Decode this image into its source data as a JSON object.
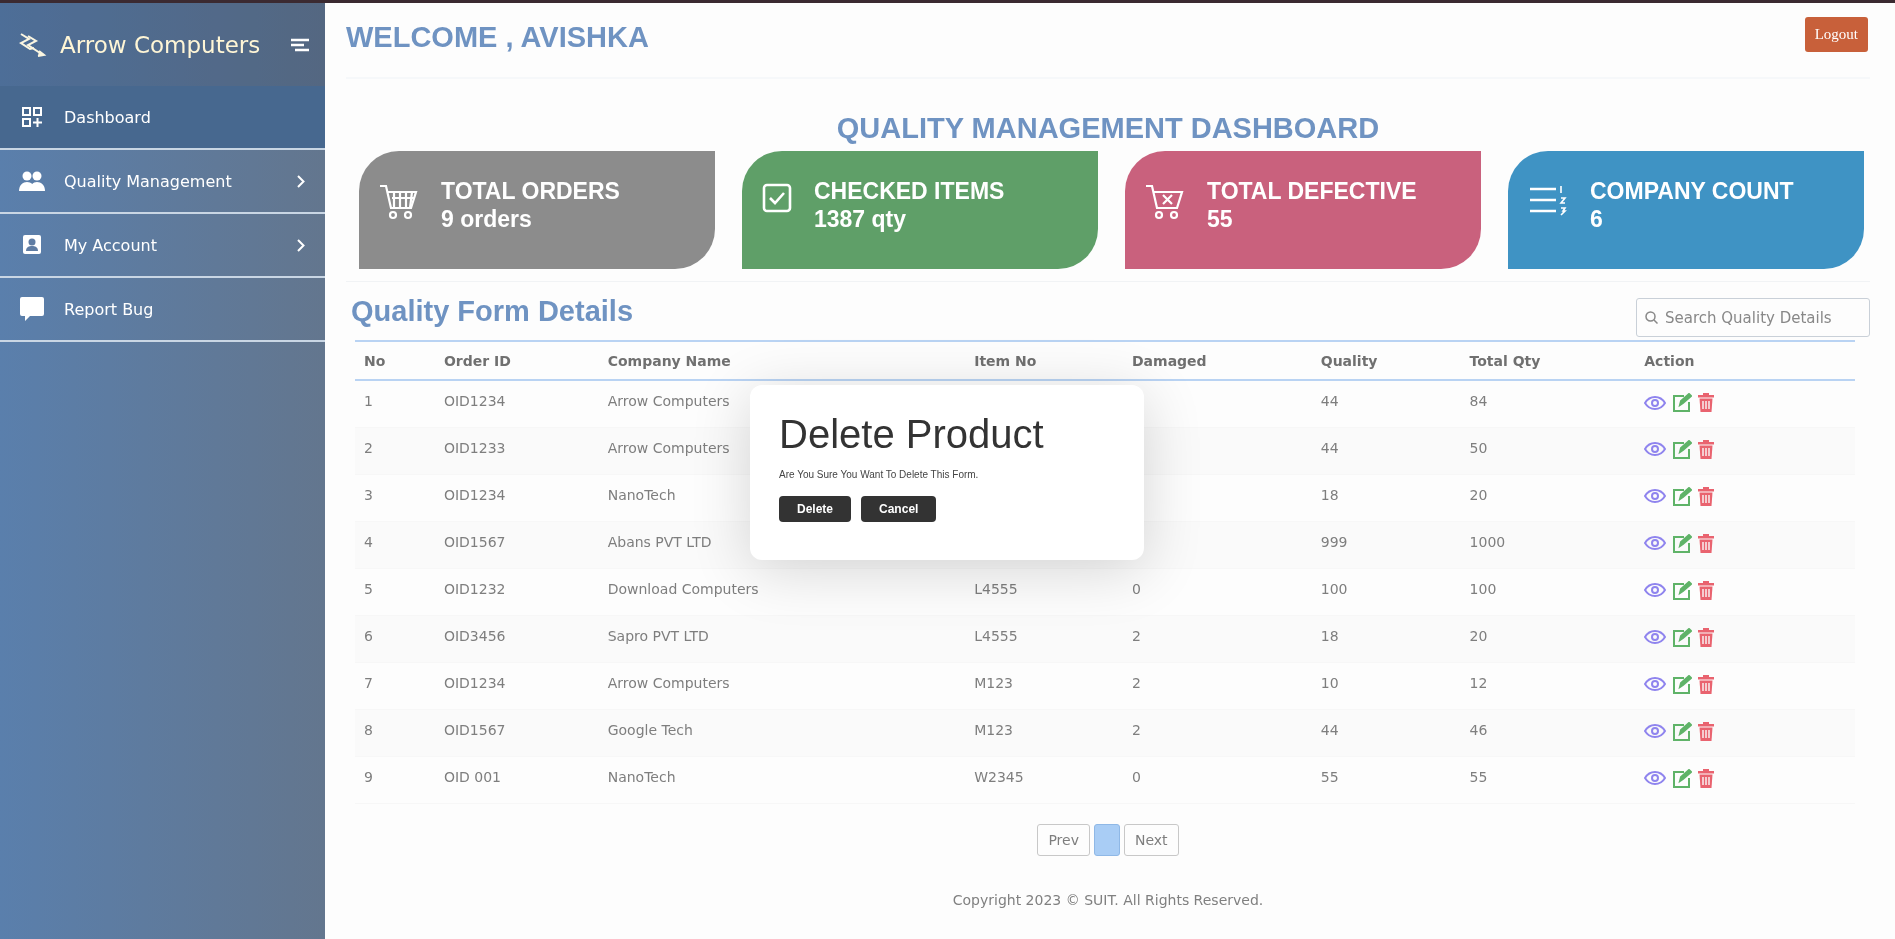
{
  "sidebar": {
    "brand": "Arrow Computers",
    "items": [
      {
        "label": "Dashboard",
        "selected": true,
        "kind": "dashboard"
      },
      {
        "label": "Quality Management",
        "selected": false,
        "kind": "people"
      },
      {
        "label": "My Account",
        "selected": false,
        "kind": "account"
      },
      {
        "label": "Report Bug",
        "selected": false,
        "kind": "chat"
      }
    ]
  },
  "header": {
    "welcome": "WELCOME , AVISHKA",
    "logout": "Logout"
  },
  "dashboard_title": "QUALITY MANAGEMENT DASHBOARD",
  "cards": [
    {
      "title": "TOTAL ORDERS",
      "value": "9 orders",
      "kind": "cart",
      "color": "#8c8c8c"
    },
    {
      "title": "CHECKED ITEMS",
      "value": "1387 qty",
      "kind": "check",
      "color": "#5f9f68"
    },
    {
      "title": "TOTAL DEFECTIVE",
      "value": "55",
      "kind": "cart-x",
      "color": "#c9617d"
    },
    {
      "title": "COMPANY COUNT",
      "value": "6",
      "kind": "list",
      "color": "#3f93c4"
    }
  ],
  "section_title": "Quality Form Details",
  "search": {
    "placeholder": "Search Quality Details"
  },
  "table": {
    "columns": [
      "No",
      "Order ID",
      "Company Name",
      "Item No",
      "Damaged",
      "Quality",
      "Total Qty",
      "Action"
    ],
    "rows": [
      {
        "no": "1",
        "order_id": "OID1234",
        "company": "Arrow Computers",
        "quality": "44",
        "total_qty": "84"
      },
      {
        "no": "2",
        "order_id": "OID1233",
        "company": "Arrow Computers",
        "quality": "44",
        "total_qty": "50"
      },
      {
        "no": "3",
        "order_id": "OID1234",
        "company": "NanoTech",
        "quality": "18",
        "total_qty": "20"
      },
      {
        "no": "4",
        "order_id": "OID1567",
        "company": "Abans PVT LTD",
        "quality": "999",
        "total_qty": "1000"
      },
      {
        "no": "5",
        "order_id": "OID1232",
        "company": "Download Computers",
        "item_no": "L4555",
        "damaged": "0",
        "quality": "100",
        "total_qty": "100"
      },
      {
        "no": "6",
        "order_id": "OID3456",
        "company": "Sapro PVT LTD",
        "item_no": "L4555",
        "damaged": "2",
        "quality": "18",
        "total_qty": "20"
      },
      {
        "no": "7",
        "order_id": "OID1234",
        "company": "Arrow Computers",
        "item_no": "M123",
        "damaged": "2",
        "quality": "10",
        "total_qty": "12"
      },
      {
        "no": "8",
        "order_id": "OID1567",
        "company": "Google Tech",
        "item_no": "M123",
        "damaged": "2",
        "quality": "44",
        "total_qty": "46"
      },
      {
        "no": "9",
        "order_id": "OID 001",
        "company": "NanoTech",
        "item_no": "W2345",
        "damaged": "0",
        "quality": "55",
        "total_qty": "55"
      }
    ]
  },
  "pagination": {
    "prev": "Prev",
    "pages": [
      {
        "selected": true
      }
    ],
    "next": "Next"
  },
  "footer": "Copyright 2023 © SUIT. All Rights Reserved.",
  "modal": {
    "title": "Delete Product",
    "message": "Are You Sure You Want To Delete This Form.",
    "buttons": [
      "Delete",
      "Cancel"
    ]
  }
}
